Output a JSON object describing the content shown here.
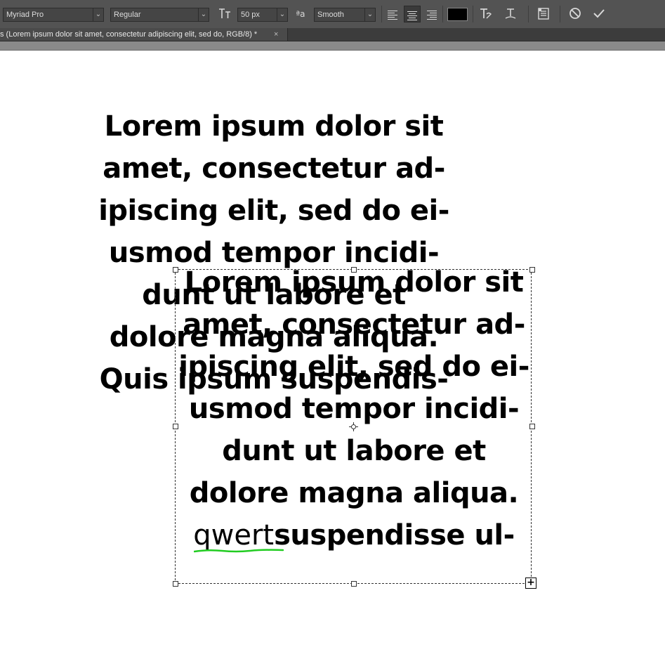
{
  "options_bar": {
    "font_family": "Myriad Pro",
    "font_style": "Regular",
    "font_size": "50 px",
    "anti_alias": "Smooth",
    "text_color": "#000000",
    "icons": {
      "toggle_orientation": "text-orientation-icon",
      "antialias": "antialias-icon",
      "warp": "warp-text-icon",
      "baseline": "baseline-icon",
      "panels": "character-paragraph-panels-icon",
      "cancel": "cancel-icon",
      "commit": "commit-checkmark-icon"
    },
    "alignment_selected": "center"
  },
  "document_tab": {
    "title": "s (Lorem ipsum dolor sit amet, consectetur adipiscing elit, sed do, RGB/8) *",
    "close": "×"
  },
  "canvas": {
    "background": "#ffffff",
    "text_layer_1": {
      "lines": [
        "Lorem ipsum dolor sit",
        "amet, consectetur ad-",
        "ipiscing elit, sed do ei-",
        "usmod tempor incidi-",
        "dunt ut labore et",
        "dolore magna aliqua.",
        "Quis ipsum suspendis-"
      ]
    },
    "text_layer_2": {
      "lines": [
        "Lorem ipsum dolor sit",
        "amet, consectetur ad-",
        "ipiscing elit, sed do ei-",
        "usmod tempor incidi-",
        "dunt ut labore et",
        "dolore magna aliqua."
      ],
      "editing_typed": "qwert",
      "editing_rest": "suspendisse ul-",
      "spell_underline_color": "#22cc22"
    }
  }
}
